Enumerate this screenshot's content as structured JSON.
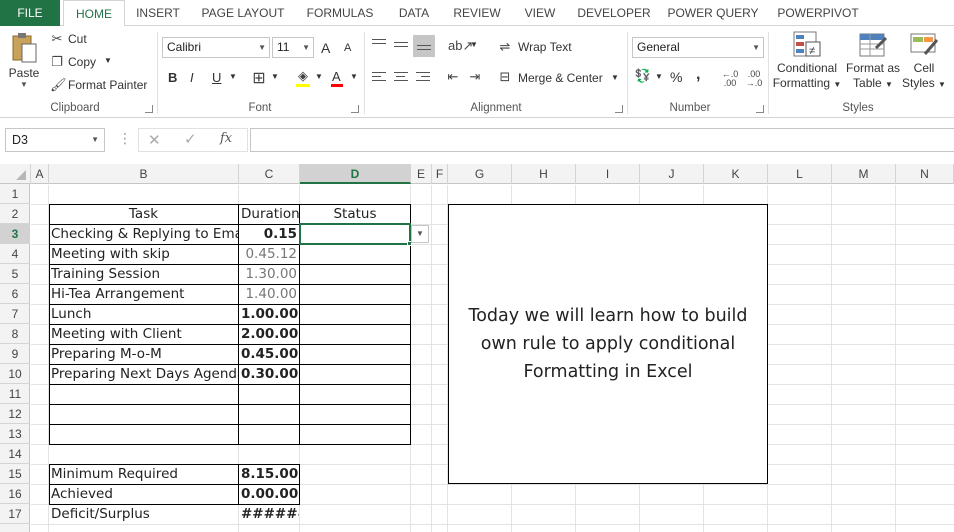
{
  "tabs": [
    "FILE",
    "HOME",
    "INSERT",
    "PAGE LAYOUT",
    "FORMULAS",
    "DATA",
    "REVIEW",
    "VIEW",
    "DEVELOPER",
    "POWER QUERY",
    "POWERPIVOT"
  ],
  "ribbon": {
    "clipboard": {
      "label": "Clipboard",
      "paste": "Paste",
      "cut": "Cut",
      "copy": "Copy",
      "format_painter": "Format Painter"
    },
    "font": {
      "label": "Font",
      "font_name": "Calibri",
      "font_size": "11",
      "grow": "A",
      "shrink": "A",
      "bold": "B",
      "italic": "I",
      "underline": "U",
      "font_color": "A"
    },
    "alignment": {
      "label": "Alignment",
      "wrap_text": "Wrap Text",
      "merge_center": "Merge & Center"
    },
    "number": {
      "label": "Number",
      "format": "General",
      "percent": "%",
      "comma": ","
    },
    "styles": {
      "label": "Styles",
      "conditional_l1": "Conditional",
      "conditional_l2": "Formatting",
      "format_table_l1": "Format as",
      "format_table_l2": "Table",
      "cell_styles_l1": "Cell",
      "cell_styles_l2": "Styles"
    }
  },
  "formula_bar": {
    "name_box": "D3",
    "fx": "fx",
    "value": ""
  },
  "columns": [
    "A",
    "B",
    "C",
    "D",
    "E",
    "F",
    "G",
    "H",
    "I",
    "J",
    "K",
    "L",
    "M",
    "N"
  ],
  "selected_column": "D",
  "rows": [
    "1",
    "2",
    "3",
    "4",
    "5",
    "6",
    "7",
    "8",
    "9",
    "10",
    "11",
    "12",
    "13",
    "14",
    "15",
    "16",
    "17"
  ],
  "selected_row": "3",
  "table": {
    "headers": {
      "task": "Task",
      "duration": "Duration",
      "status": "Status"
    },
    "rows": [
      {
        "task": "Checking & Replying to Email",
        "duration": "0.15"
      },
      {
        "task": "Meeting with skip",
        "duration": "0.45.12"
      },
      {
        "task": "Training Session",
        "duration": "1.30.00"
      },
      {
        "task": "Hi-Tea Arrangement",
        "duration": "1.40.00"
      },
      {
        "task": "Lunch",
        "duration": "1.00.00"
      },
      {
        "task": "Meeting with Client",
        "duration": "2.00.00"
      },
      {
        "task": "Preparing M-o-M",
        "duration": "0.45.00"
      },
      {
        "task": "Preparing Next Days Agenda",
        "duration": "0.30.00"
      }
    ]
  },
  "summary": [
    {
      "label": "Minimum Required",
      "value": "8.15.00"
    },
    {
      "label": "Achieved",
      "value": "0.00.00"
    },
    {
      "label": "Deficit/Surplus",
      "value": "########"
    }
  ],
  "textbox": "Today we will learn how to build own rule to apply conditional Formatting in Excel",
  "colors": {
    "excel_green": "#217346",
    "selection": "#217346"
  }
}
